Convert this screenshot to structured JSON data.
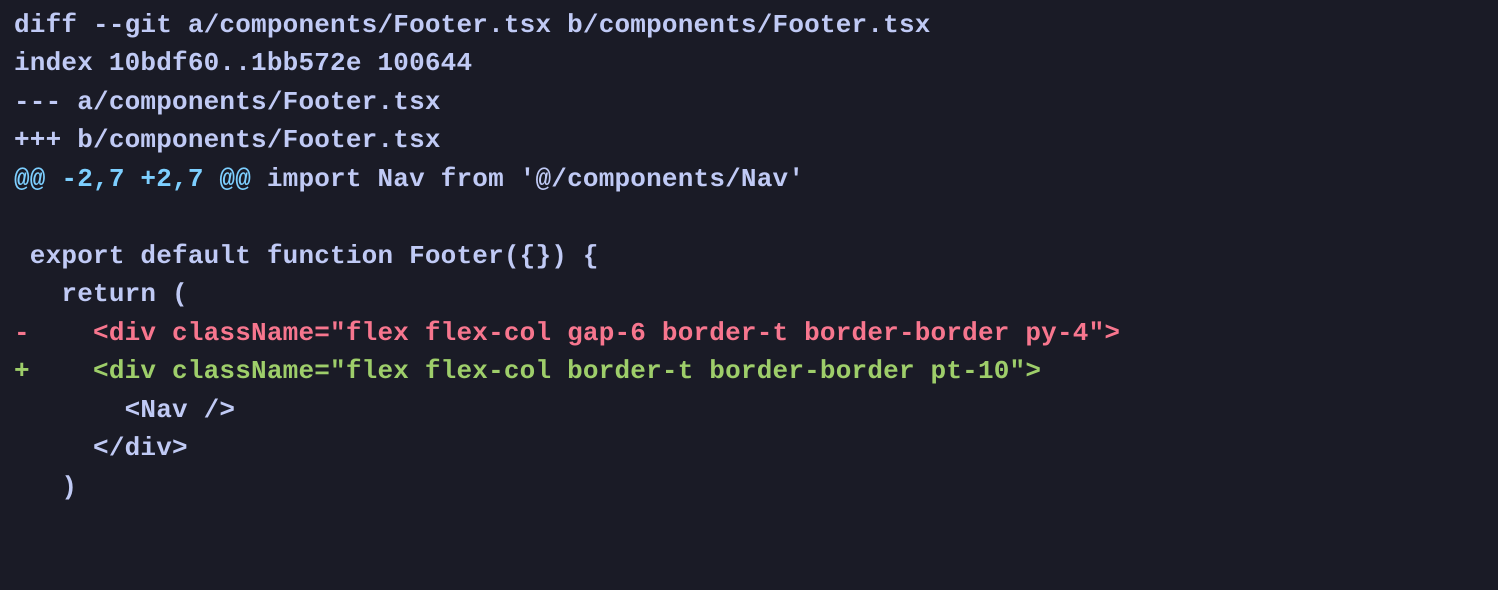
{
  "diff": {
    "file_a": "a/components/Footer.tsx",
    "file_b": "b/components/Footer.tsx",
    "index_from": "10bdf60",
    "index_to": "1bb572e",
    "mode": "100644",
    "hunk_header": "@@ -2,7 +2,7 @@",
    "hunk_context": "import Nav from '@/components/Nav'",
    "lines": {
      "l0": "diff --git a/components/Footer.tsx b/components/Footer.tsx",
      "l1": "index 10bdf60..1bb572e 100644",
      "l2": "--- a/components/Footer.tsx",
      "l3": "+++ b/components/Footer.tsx",
      "l4_hunk": "@@ -2,7 +2,7 @@ ",
      "l4_ctx": "import Nav from '@/components/Nav'",
      "l5": " ",
      "l6": " export default function Footer({}) {",
      "l7": "   return (",
      "l8": "-    <div className=\"flex flex-col gap-6 border-t border-border py-4\">",
      "l9": "+    <div className=\"flex flex-col border-t border-border pt-10\">",
      "l10": "       <Nav />",
      "l11": "     </div>",
      "l12": "   )"
    }
  },
  "colors": {
    "background": "#1a1b26",
    "foreground": "#c0caf5",
    "hunk": "#7dcfff",
    "deletion": "#f7768e",
    "addition": "#9ece6a"
  }
}
